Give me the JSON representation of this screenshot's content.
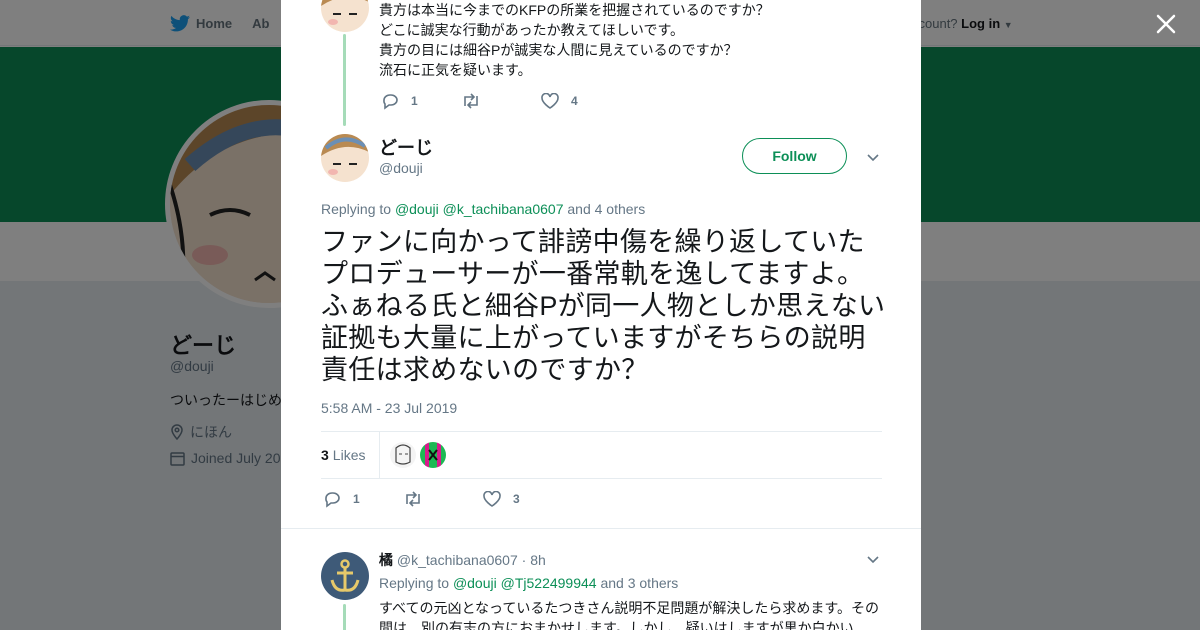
{
  "background": {
    "nav": {
      "home_label": "Home",
      "about_label": "Ab"
    },
    "login": {
      "prompt": "ccount?",
      "login_label": "Log in"
    },
    "profile": {
      "name": "どーじ",
      "handle": "@douji",
      "bio": "ついったーはじめ",
      "location": "にほん",
      "joined": "Joined July 20"
    },
    "brand_color": "#0c8f57"
  },
  "modal": {
    "previous_tweet": {
      "lines": "貴方は本当に今までのKFPの所業を把握されているのですか？\nどこに誠実な行動があったか教えてほしいです。\n貴方の目には細谷Pが誠実な人間に見えているのですか？\n流石に正気を疑います。",
      "replies": "1",
      "retweets": "",
      "likes": "4"
    },
    "tweet": {
      "author_name": "どーじ",
      "author_handle": "@douji",
      "follow_label": "Follow",
      "replying_to_prefix": "Replying to",
      "replying_to_mentions": "@douji @k_tachibana0607",
      "replying_to_suffix": "and 4 others",
      "text": "ファンに向かって誹謗中傷を繰り返していたプロデューサーが一番常軌を逸してますよ。ふぁねる氏と細谷Pが同一人物としか思えない証拠も大量に上がっていますがそちらの説明責任は求めないのですか？",
      "timestamp": "5:58 AM - 23 Jul 2019",
      "likes_count": "3",
      "likes_label": "Likes",
      "replies": "1",
      "retweets": "",
      "likes": "3"
    },
    "reply": {
      "author_name": "橘",
      "author_handle": "@k_tachibana0607",
      "time": "· 8h",
      "replying_to_prefix": "Replying to",
      "replying_to_mentions": "@douji @Tj522499944",
      "replying_to_suffix": "and 3 others",
      "text": "すべての元凶となっているたつきさん説明不足問題が解決したら求めます。その間は、別の有志の方におまかせします。しかし、疑いはしますが黒か白かい"
    }
  }
}
